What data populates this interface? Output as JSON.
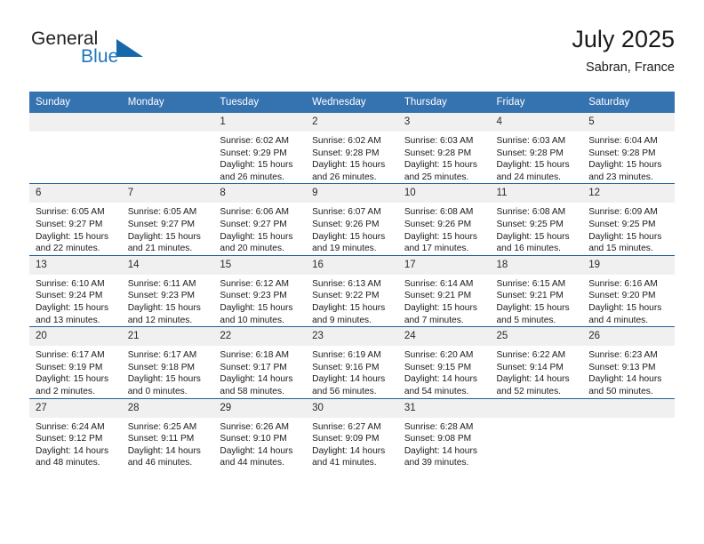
{
  "brand": {
    "name_part1": "General",
    "name_part2": "Blue",
    "flag_icon": "triangle-flag-icon"
  },
  "header": {
    "title": "July 2025",
    "location": "Sabran, France"
  },
  "colors": {
    "header_blue": "#3572b0",
    "row_divider_blue": "#1d5fa0",
    "daynum_band": "#f0f0f0",
    "brand_blue": "#1d75bd",
    "text": "#1a1a1a"
  },
  "calendar": {
    "weekday_headers": [
      "Sunday",
      "Monday",
      "Tuesday",
      "Wednesday",
      "Thursday",
      "Friday",
      "Saturday"
    ],
    "weeks": [
      [
        {
          "day": "",
          "sunrise": "",
          "sunset": "",
          "daylight_line1": "",
          "daylight_line2": ""
        },
        {
          "day": "",
          "sunrise": "",
          "sunset": "",
          "daylight_line1": "",
          "daylight_line2": ""
        },
        {
          "day": "1",
          "sunrise": "Sunrise: 6:02 AM",
          "sunset": "Sunset: 9:29 PM",
          "daylight_line1": "Daylight: 15 hours",
          "daylight_line2": "and 26 minutes."
        },
        {
          "day": "2",
          "sunrise": "Sunrise: 6:02 AM",
          "sunset": "Sunset: 9:28 PM",
          "daylight_line1": "Daylight: 15 hours",
          "daylight_line2": "and 26 minutes."
        },
        {
          "day": "3",
          "sunrise": "Sunrise: 6:03 AM",
          "sunset": "Sunset: 9:28 PM",
          "daylight_line1": "Daylight: 15 hours",
          "daylight_line2": "and 25 minutes."
        },
        {
          "day": "4",
          "sunrise": "Sunrise: 6:03 AM",
          "sunset": "Sunset: 9:28 PM",
          "daylight_line1": "Daylight: 15 hours",
          "daylight_line2": "and 24 minutes."
        },
        {
          "day": "5",
          "sunrise": "Sunrise: 6:04 AM",
          "sunset": "Sunset: 9:28 PM",
          "daylight_line1": "Daylight: 15 hours",
          "daylight_line2": "and 23 minutes."
        }
      ],
      [
        {
          "day": "6",
          "sunrise": "Sunrise: 6:05 AM",
          "sunset": "Sunset: 9:27 PM",
          "daylight_line1": "Daylight: 15 hours",
          "daylight_line2": "and 22 minutes."
        },
        {
          "day": "7",
          "sunrise": "Sunrise: 6:05 AM",
          "sunset": "Sunset: 9:27 PM",
          "daylight_line1": "Daylight: 15 hours",
          "daylight_line2": "and 21 minutes."
        },
        {
          "day": "8",
          "sunrise": "Sunrise: 6:06 AM",
          "sunset": "Sunset: 9:27 PM",
          "daylight_line1": "Daylight: 15 hours",
          "daylight_line2": "and 20 minutes."
        },
        {
          "day": "9",
          "sunrise": "Sunrise: 6:07 AM",
          "sunset": "Sunset: 9:26 PM",
          "daylight_line1": "Daylight: 15 hours",
          "daylight_line2": "and 19 minutes."
        },
        {
          "day": "10",
          "sunrise": "Sunrise: 6:08 AM",
          "sunset": "Sunset: 9:26 PM",
          "daylight_line1": "Daylight: 15 hours",
          "daylight_line2": "and 17 minutes."
        },
        {
          "day": "11",
          "sunrise": "Sunrise: 6:08 AM",
          "sunset": "Sunset: 9:25 PM",
          "daylight_line1": "Daylight: 15 hours",
          "daylight_line2": "and 16 minutes."
        },
        {
          "day": "12",
          "sunrise": "Sunrise: 6:09 AM",
          "sunset": "Sunset: 9:25 PM",
          "daylight_line1": "Daylight: 15 hours",
          "daylight_line2": "and 15 minutes."
        }
      ],
      [
        {
          "day": "13",
          "sunrise": "Sunrise: 6:10 AM",
          "sunset": "Sunset: 9:24 PM",
          "daylight_line1": "Daylight: 15 hours",
          "daylight_line2": "and 13 minutes."
        },
        {
          "day": "14",
          "sunrise": "Sunrise: 6:11 AM",
          "sunset": "Sunset: 9:23 PM",
          "daylight_line1": "Daylight: 15 hours",
          "daylight_line2": "and 12 minutes."
        },
        {
          "day": "15",
          "sunrise": "Sunrise: 6:12 AM",
          "sunset": "Sunset: 9:23 PM",
          "daylight_line1": "Daylight: 15 hours",
          "daylight_line2": "and 10 minutes."
        },
        {
          "day": "16",
          "sunrise": "Sunrise: 6:13 AM",
          "sunset": "Sunset: 9:22 PM",
          "daylight_line1": "Daylight: 15 hours",
          "daylight_line2": "and 9 minutes."
        },
        {
          "day": "17",
          "sunrise": "Sunrise: 6:14 AM",
          "sunset": "Sunset: 9:21 PM",
          "daylight_line1": "Daylight: 15 hours",
          "daylight_line2": "and 7 minutes."
        },
        {
          "day": "18",
          "sunrise": "Sunrise: 6:15 AM",
          "sunset": "Sunset: 9:21 PM",
          "daylight_line1": "Daylight: 15 hours",
          "daylight_line2": "and 5 minutes."
        },
        {
          "day": "19",
          "sunrise": "Sunrise: 6:16 AM",
          "sunset": "Sunset: 9:20 PM",
          "daylight_line1": "Daylight: 15 hours",
          "daylight_line2": "and 4 minutes."
        }
      ],
      [
        {
          "day": "20",
          "sunrise": "Sunrise: 6:17 AM",
          "sunset": "Sunset: 9:19 PM",
          "daylight_line1": "Daylight: 15 hours",
          "daylight_line2": "and 2 minutes."
        },
        {
          "day": "21",
          "sunrise": "Sunrise: 6:17 AM",
          "sunset": "Sunset: 9:18 PM",
          "daylight_line1": "Daylight: 15 hours",
          "daylight_line2": "and 0 minutes."
        },
        {
          "day": "22",
          "sunrise": "Sunrise: 6:18 AM",
          "sunset": "Sunset: 9:17 PM",
          "daylight_line1": "Daylight: 14 hours",
          "daylight_line2": "and 58 minutes."
        },
        {
          "day": "23",
          "sunrise": "Sunrise: 6:19 AM",
          "sunset": "Sunset: 9:16 PM",
          "daylight_line1": "Daylight: 14 hours",
          "daylight_line2": "and 56 minutes."
        },
        {
          "day": "24",
          "sunrise": "Sunrise: 6:20 AM",
          "sunset": "Sunset: 9:15 PM",
          "daylight_line1": "Daylight: 14 hours",
          "daylight_line2": "and 54 minutes."
        },
        {
          "day": "25",
          "sunrise": "Sunrise: 6:22 AM",
          "sunset": "Sunset: 9:14 PM",
          "daylight_line1": "Daylight: 14 hours",
          "daylight_line2": "and 52 minutes."
        },
        {
          "day": "26",
          "sunrise": "Sunrise: 6:23 AM",
          "sunset": "Sunset: 9:13 PM",
          "daylight_line1": "Daylight: 14 hours",
          "daylight_line2": "and 50 minutes."
        }
      ],
      [
        {
          "day": "27",
          "sunrise": "Sunrise: 6:24 AM",
          "sunset": "Sunset: 9:12 PM",
          "daylight_line1": "Daylight: 14 hours",
          "daylight_line2": "and 48 minutes."
        },
        {
          "day": "28",
          "sunrise": "Sunrise: 6:25 AM",
          "sunset": "Sunset: 9:11 PM",
          "daylight_line1": "Daylight: 14 hours",
          "daylight_line2": "and 46 minutes."
        },
        {
          "day": "29",
          "sunrise": "Sunrise: 6:26 AM",
          "sunset": "Sunset: 9:10 PM",
          "daylight_line1": "Daylight: 14 hours",
          "daylight_line2": "and 44 minutes."
        },
        {
          "day": "30",
          "sunrise": "Sunrise: 6:27 AM",
          "sunset": "Sunset: 9:09 PM",
          "daylight_line1": "Daylight: 14 hours",
          "daylight_line2": "and 41 minutes."
        },
        {
          "day": "31",
          "sunrise": "Sunrise: 6:28 AM",
          "sunset": "Sunset: 9:08 PM",
          "daylight_line1": "Daylight: 14 hours",
          "daylight_line2": "and 39 minutes."
        },
        {
          "day": "",
          "sunrise": "",
          "sunset": "",
          "daylight_line1": "",
          "daylight_line2": ""
        },
        {
          "day": "",
          "sunrise": "",
          "sunset": "",
          "daylight_line1": "",
          "daylight_line2": ""
        }
      ]
    ]
  }
}
